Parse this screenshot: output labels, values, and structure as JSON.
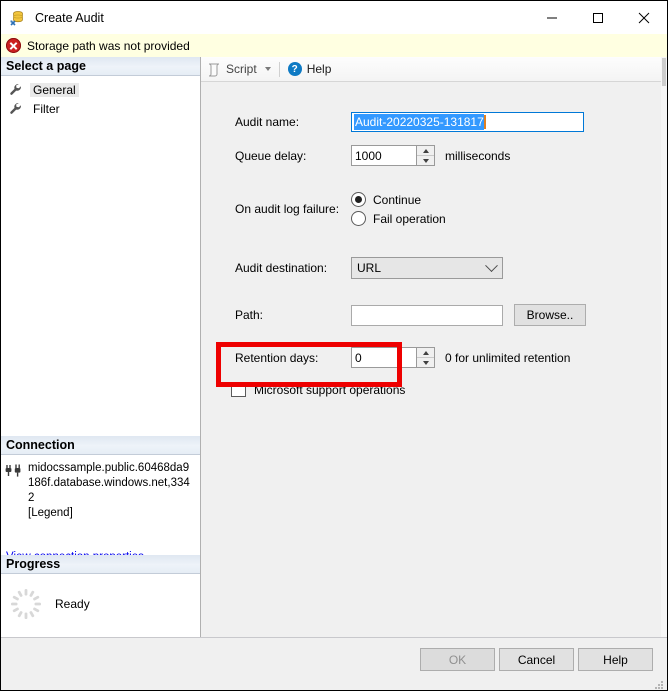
{
  "window": {
    "title": "Create Audit",
    "icon": "sql-audit-icon",
    "minimize_label": "─",
    "maximize_label": "□",
    "close_label": "✕"
  },
  "error_bar": {
    "icon": "error-circle-x-icon",
    "message": "Storage path was not provided",
    "background": "#ffffe1"
  },
  "sidebar": {
    "select_page_header": "Select a page",
    "pages": [
      {
        "label": "General",
        "icon": "wrench-icon",
        "selected": true
      },
      {
        "label": "Filter",
        "icon": "wrench-icon",
        "selected": false
      }
    ],
    "connection": {
      "header": "Connection",
      "icon": "connection-plug-icon",
      "server": "midocssample.public.60468da9186f.database.windows.net,3342",
      "user": "[Legend]",
      "link_label": "View connection properties",
      "link_color": "#0000ee"
    },
    "progress": {
      "header": "Progress",
      "icon": "loading-spinner-icon",
      "status": "Ready"
    }
  },
  "toolbar": {
    "script_label": "Script",
    "script_icon": "script-icon",
    "dropdown_icon": "chevron-down-icon",
    "help_label": "Help",
    "help_icon": "help-question-icon"
  },
  "form": {
    "audit_name": {
      "label": "Audit name:",
      "value": "Audit-20220325-131817",
      "selected": true,
      "selection_color": "#3399ff",
      "caret_color": "#e08020"
    },
    "queue_delay": {
      "label": "Queue delay:",
      "value": "1000",
      "suffix": "milliseconds"
    },
    "on_audit_log_failure": {
      "label": "On audit log failure:",
      "options": [
        {
          "label": "Continue",
          "checked": true
        },
        {
          "label": "Fail operation",
          "checked": false
        }
      ]
    },
    "audit_destination": {
      "label": "Audit destination:",
      "value": "URL"
    },
    "path": {
      "label": "Path:",
      "value": "",
      "browse_label": "Browse.."
    },
    "retention_days": {
      "label": "Retention days:",
      "value": "0",
      "suffix": "0 for unlimited retention"
    },
    "microsoft_support_operations": {
      "label": "Microsoft support operations",
      "checked": false,
      "highlight_color": "#ee0000"
    }
  },
  "footer": {
    "ok_label": "OK",
    "ok_disabled": true,
    "cancel_label": "Cancel",
    "help_label": "Help"
  }
}
